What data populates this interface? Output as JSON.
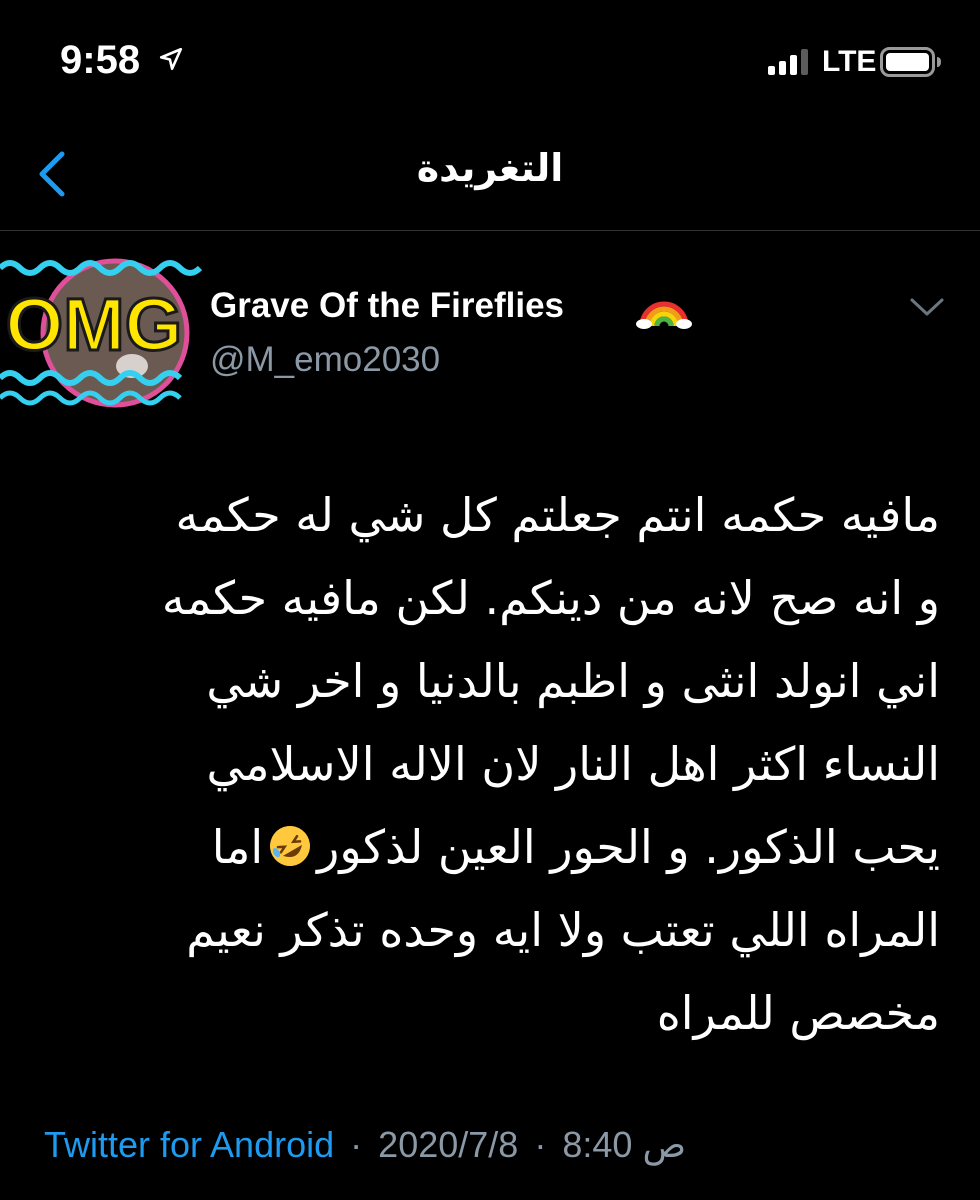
{
  "status_bar": {
    "time": "9:58",
    "network": "LTE",
    "icons": [
      "location-arrow-icon",
      "signal-bars-icon",
      "battery-icon"
    ]
  },
  "nav": {
    "title": "التغريدة",
    "back_icon": "chevron-left-icon"
  },
  "tweet": {
    "author": {
      "name": "Grave Of the Fireflies",
      "name_emoji": "rainbow-icon",
      "handle": "@M_emo2030",
      "avatar_badge_text": "OMG"
    },
    "lines": [
      "مافيه حكمه انتم جعلتم كل شي له حكمه",
      "و انه صح لانه من دينكم. لكن مافيه حكمه",
      "اني انولد انثى و اظبم بالدنيا و اخر شي",
      "النساء اكثر اهل النار لان الاله الاسلامي",
      "يحب الذكور. و الحور العين لذكور",
      "اما",
      "المراه اللي تعتب ولا ايه وحده تذكر نعيم",
      "مخصص للمراه"
    ],
    "emoji": "rolling-on-floor-laughing-icon",
    "meta": {
      "source": "Twitter for Android",
      "date": "2020/7/8",
      "time": "8:40",
      "ampm": "ص",
      "separator": "·"
    }
  },
  "colors": {
    "background": "#000000",
    "text": "#ffffff",
    "secondary": "#8b98a5",
    "accent": "#1d9bf0",
    "divider": "#2f3336"
  }
}
